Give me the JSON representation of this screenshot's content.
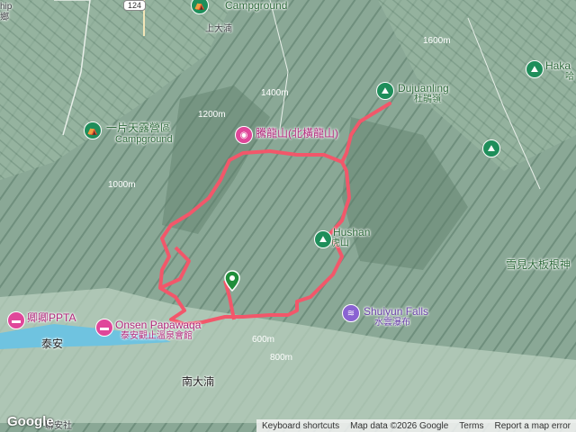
{
  "colors": {
    "route": "#f2576a",
    "terrain": "#8fae9a",
    "valley": "#cfe0d3",
    "water": "#6fc3e0"
  },
  "labels": {
    "top_left_frag": "hip",
    "top_left_frag2": "鄉",
    "road_badge": "124",
    "campground_top": "Campground",
    "shangdahu": "上大湳",
    "campground_label": "一片天露營區",
    "campground_label2": "Campground",
    "tenglong": "騰龍山(北橫龍山)",
    "duijuanling": "Dujuanling",
    "duijuanling_zh": "杜鵑嶺",
    "hushan": "Hushan",
    "hushan_zh": "虎山",
    "haka": "Haka",
    "haka_zh": "哈",
    "xuejian": "雪見大板根神",
    "shuiyun": "Shuiyun Falls",
    "shuiyun_zh": "水雲瀑布",
    "onsen": "Onsen Papawaqa",
    "onsen_zh": "泰安觀止溫泉會館",
    "ppta": "卿卿PPTA",
    "taian": "泰安",
    "nandahu": "南大湳",
    "bottom_frag": "聯安社",
    "elev_1400": "1400m",
    "elev_1200": "1200m",
    "elev_1600": "1600m",
    "elev_1000": "1000m",
    "elev_800": "800m",
    "elev_600": "600m"
  },
  "icons": {
    "campground": "tent-icon",
    "peak": "hiker-icon",
    "hotel": "bed-icon",
    "attraction": "camera-icon",
    "waterfall": "waterfall-icon",
    "marker": "location-pin-icon"
  },
  "footer": {
    "google_logo": "Google",
    "keyboard": "Keyboard shortcuts",
    "mapdata": "Map data ©2026 Google",
    "terms": "Terms",
    "report": "Report a map error"
  }
}
